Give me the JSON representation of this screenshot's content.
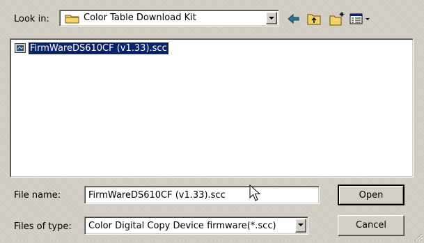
{
  "look_in": {
    "label": "Look in:",
    "folder": "Color Table Download Kit"
  },
  "toolbar": {
    "icons": [
      "back-arrow-icon",
      "up-folder-icon",
      "new-folder-icon",
      "view-menu-icon"
    ]
  },
  "file_list": {
    "items": [
      {
        "name": "FirmWareDS610CF (v1.33).scc",
        "selected": true
      }
    ]
  },
  "file_name": {
    "label": "File name:",
    "value": "FirmWareDS610CF (v1.33).scc"
  },
  "file_type": {
    "label": "Files of type:",
    "value": "Color Digital Copy Device firmware(*.scc)"
  },
  "buttons": {
    "open": "Open",
    "cancel": "Cancel"
  },
  "colors": {
    "face": "#d4d0c8",
    "selection": "#0a246a",
    "arrow_green": "#2b6f3c",
    "folder_yellow": "#f4d36b"
  }
}
